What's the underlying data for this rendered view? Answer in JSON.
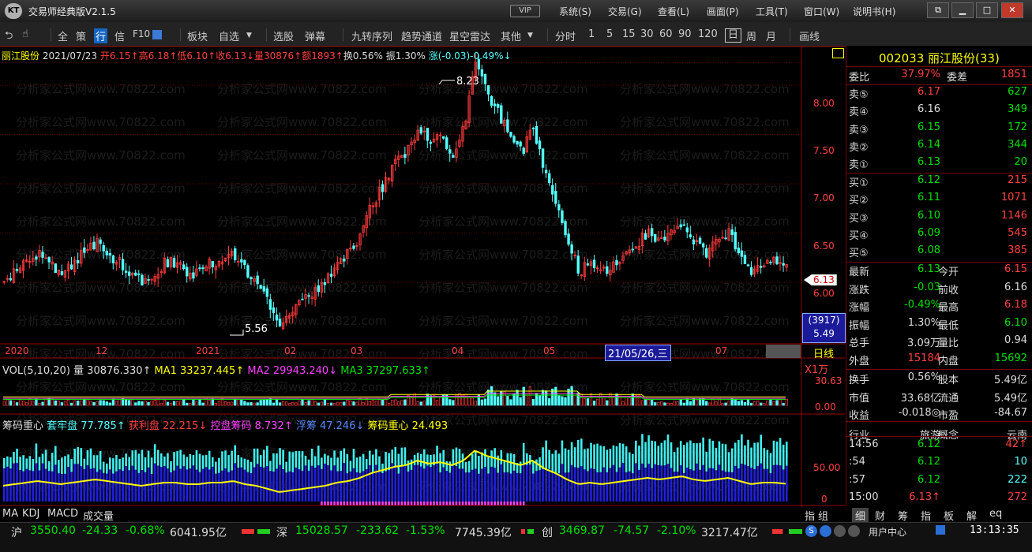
{
  "window": {
    "title": "交易师经典版V2.1.5",
    "logo": "KT",
    "vip": "VIP",
    "menus": [
      "系统(S)",
      "交易(G)",
      "查看(L)",
      "画面(P)",
      "工具(T)",
      "窗口(W)",
      "说明书(H)"
    ],
    "controls": [
      "restore-icon",
      "minimize-icon",
      "maximize-icon",
      "close-icon"
    ]
  },
  "toolbar": {
    "icons": [
      "back-icon",
      "hand-icon"
    ],
    "items": [
      "全",
      "策",
      "行",
      "信",
      "F10",
      "",
      "板块",
      "自选",
      "选股",
      "弹幕",
      "九转序列",
      "趋势通道",
      "星空雷达",
      "其他",
      "分时",
      "1",
      "5",
      "15",
      "30",
      "60",
      "90",
      "120",
      "日",
      "周",
      "月",
      "画线"
    ]
  },
  "chart": {
    "info": {
      "name": "丽江股份",
      "date": "2021/07/23",
      "open": "开6.15↑",
      "high": "高6.18↑",
      "low": "低6.10↑",
      "close": "收6.13↓",
      "vol": "量30876↑",
      "amount": "额1893↑",
      "turnover": "换0.56%",
      "amplitude": "振1.30%",
      "change": "涨(-0.03)-0.49%↓"
    },
    "price_axis": [
      "8.00",
      "7.50",
      "7.00",
      "6.50",
      "6.00"
    ],
    "high_mark": "8.23",
    "low_mark": "5.56",
    "current_price": "6.13",
    "cursor_box": [
      "(3917)",
      "5.49"
    ],
    "date_axis": [
      "2020",
      "12",
      "2021",
      "02",
      "03",
      "04",
      "05",
      "07"
    ],
    "date_tooltip": "21/05/26,三",
    "period": "日线",
    "watermark": "分析家公式网www.70822.com",
    "vol_header": {
      "title": "VOL(5,10,20)",
      "vol": "量 30876.330↑",
      "ma1": "MA1 33237.445↑",
      "ma2": "MA2 29943.240↓",
      "ma3": "MA3 37297.633↑"
    },
    "vol_unit": "X1万",
    "vol_axis": [
      "30.63",
      "0.00"
    ],
    "chip_header": {
      "title": "筹码重心",
      "trapped": "套牢盘 77.785↑",
      "profit": "获利盘 22.215↓",
      "controlled": "控盘筹码 8.732↑",
      "floating": "浮筹 47.246↓",
      "center": "筹码重心 24.493"
    },
    "chip_axis": [
      "50.00",
      "0"
    ],
    "indicator_tabs": [
      "MA",
      "KDJ",
      "MACD",
      "成交量"
    ],
    "right_tabs": [
      "指",
      "组"
    ]
  },
  "chart_data": {
    "type": "candlestick",
    "title": "丽江股份 002033",
    "x_labels": [
      "2020",
      "12",
      "2021",
      "02",
      "03",
      "04",
      "05",
      "07"
    ],
    "ylim": [
      5.4,
      8.4
    ],
    "price_path": [
      6.0,
      6.1,
      6.2,
      6.3,
      6.2,
      6.1,
      6.2,
      6.3,
      6.4,
      6.3,
      6.2,
      6.1,
      6.0,
      6.1,
      6.2,
      6.2,
      6.1,
      6.1,
      6.2,
      6.2,
      6.3,
      6.1,
      6.0,
      5.8,
      5.6,
      5.7,
      5.8,
      5.9,
      6.0,
      6.2,
      6.3,
      6.5,
      6.8,
      7.0,
      7.2,
      7.3,
      7.6,
      7.4,
      7.5,
      7.3,
      7.6,
      8.23,
      7.9,
      7.7,
      7.5,
      7.3,
      7.6,
      7.1,
      6.8,
      6.4,
      6.1,
      6.2,
      6.1,
      6.2,
      6.3,
      6.4,
      6.5,
      6.4,
      6.5,
      6.6,
      6.4,
      6.3,
      6.4,
      6.5,
      6.3,
      6.1,
      6.2,
      6.2,
      6.13
    ],
    "annotations": {
      "high": 8.23,
      "low": 5.56,
      "last": 6.13
    },
    "volume_ylim": [
      0,
      30.63
    ],
    "chip_series": [
      "套牢盘",
      "获利盘",
      "控盘筹码",
      "浮筹",
      "筹码重心"
    ]
  },
  "quote_panel": {
    "code_name": "002033 丽江股份(33)",
    "weibi": {
      "label": "委比",
      "value": "37.97%",
      "label2": "委差",
      "value2": "1851"
    },
    "asks": [
      {
        "label": "卖⑤",
        "price": "6.17",
        "vol": "627"
      },
      {
        "label": "卖④",
        "price": "6.16",
        "vol": "349"
      },
      {
        "label": "卖③",
        "price": "6.15",
        "vol": "172"
      },
      {
        "label": "卖②",
        "price": "6.14",
        "vol": "344"
      },
      {
        "label": "卖①",
        "price": "6.13",
        "vol": "20"
      }
    ],
    "bids": [
      {
        "label": "买①",
        "price": "6.12",
        "vol": "215"
      },
      {
        "label": "买②",
        "price": "6.11",
        "vol": "1071"
      },
      {
        "label": "买③",
        "price": "6.10",
        "vol": "1146"
      },
      {
        "label": "买④",
        "price": "6.09",
        "vol": "545"
      },
      {
        "label": "买⑤",
        "price": "6.08",
        "vol": "385"
      }
    ],
    "stats": [
      [
        "最新",
        "6.13",
        "今开",
        "6.15"
      ],
      [
        "涨跌",
        "-0.03",
        "前收",
        "6.16"
      ],
      [
        "涨幅",
        "-0.49%",
        "最高",
        "6.18"
      ],
      [
        "振幅",
        "1.30%",
        "最低",
        "6.10"
      ],
      [
        "总手",
        "3.09万",
        "量比",
        "0.94"
      ],
      [
        "外盘",
        "15184",
        "内盘",
        "15692"
      ],
      [
        "换手",
        "0.56%",
        "股本",
        "5.49亿"
      ],
      [
        "市值",
        "33.68亿",
        "流通",
        "5.49亿"
      ],
      [
        "收益",
        "-0.018◎",
        "市盈",
        "-84.67"
      ],
      [
        "行业",
        "旅游",
        "概念",
        "云南"
      ]
    ],
    "ticks": [
      {
        "time": "14:56",
        "price": "6.12",
        "vol": "42↑"
      },
      {
        "time": ":54",
        "price": "6.12",
        "vol": "10"
      },
      {
        "time": ":57",
        "price": "6.12",
        "vol": "222"
      },
      {
        "time": "15:00",
        "price": "6.13↑",
        "vol": "272"
      }
    ],
    "tabs": [
      "细",
      "财",
      "筹",
      "指",
      "板",
      "解",
      "eq"
    ]
  },
  "status_bar": {
    "sh": {
      "name": "沪",
      "index": "3550.40",
      "chg": "-24.33",
      "pct": "-0.68%",
      "amt": "6041.95亿"
    },
    "sz": {
      "name": "深",
      "index": "15028.57",
      "chg": "-233.62",
      "pct": "-1.53%",
      "amt": "7745.39亿"
    },
    "cy": {
      "name": "创",
      "index": "3469.87",
      "chg": "-74.57",
      "pct": "-2.10%",
      "amt": "3217.47亿"
    },
    "user_center": "用户中心",
    "time": "13:13:35"
  }
}
